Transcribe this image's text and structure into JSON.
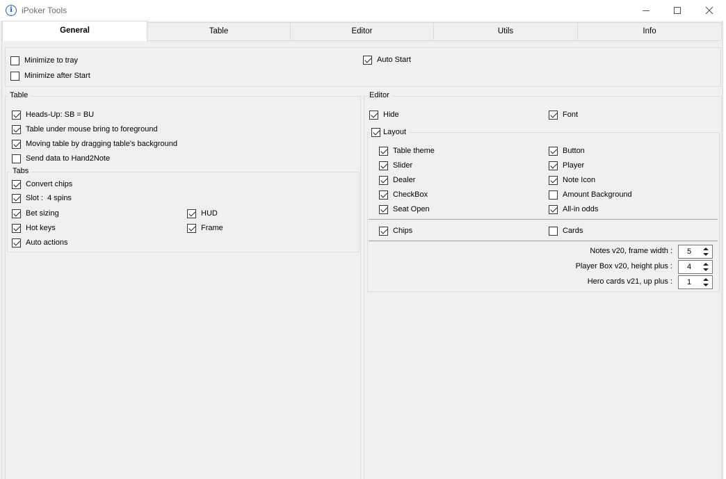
{
  "window": {
    "title": "iPoker Tools",
    "app_icon_glyph": "i",
    "app_icon": "info-icon"
  },
  "tabs": [
    {
      "label": "General"
    },
    {
      "label": "Table"
    },
    {
      "label": "Editor"
    },
    {
      "label": "Utils"
    },
    {
      "label": "Info"
    }
  ],
  "general": {
    "minimize_to_tray": {
      "label": "Minimize to tray",
      "checked": false
    },
    "minimize_after_start": {
      "label": "Minimize after Start",
      "checked": false
    },
    "auto_start": {
      "label": "Auto Start",
      "checked": true
    }
  },
  "table_group": {
    "label": "Table",
    "items": [
      {
        "label": "Heads-Up: SB = BU",
        "checked": true
      },
      {
        "label": "Table under mouse bring to foreground",
        "checked": true
      },
      {
        "label": "Moving table by dragging table's background",
        "checked": true
      },
      {
        "label": "Send data to Hand2Note",
        "checked": false
      }
    ]
  },
  "tabs_group": {
    "label": "Tabs",
    "convert_chips": {
      "label": "Convert chips",
      "checked": true
    },
    "slot": {
      "label": "Slot :",
      "value": "4 spins",
      "checked": true
    },
    "bet_sizing": {
      "label": "Bet sizing",
      "checked": true
    },
    "hud": {
      "label": "HUD",
      "checked": true
    },
    "hot_keys": {
      "label": "Hot keys",
      "checked": true
    },
    "frame": {
      "label": "Frame",
      "checked": true
    },
    "auto_actions": {
      "label": "Auto actions",
      "checked": true
    }
  },
  "editor_group": {
    "label": "Editor",
    "hide": {
      "label": "Hide",
      "checked": true
    },
    "font": {
      "label": "Font",
      "checked": true
    },
    "layout": {
      "label": "Layout",
      "checked": true
    },
    "layout_items": {
      "table_theme": {
        "label": "Table theme",
        "checked": true
      },
      "button": {
        "label": "Button",
        "checked": true
      },
      "slider": {
        "label": "Slider",
        "checked": true
      },
      "player": {
        "label": "Player",
        "checked": true
      },
      "dealer": {
        "label": "Dealer",
        "checked": true
      },
      "note_icon": {
        "label": "Note Icon",
        "checked": true
      },
      "checkbox": {
        "label": "CheckBox",
        "checked": true
      },
      "amount_background": {
        "label": "Amount Background",
        "checked": false
      },
      "seat_open": {
        "label": "Seat Open",
        "checked": true
      },
      "all_in_odds": {
        "label": "All-in odds",
        "checked": true
      }
    },
    "chips": {
      "label": "Chips",
      "checked": true
    },
    "cards": {
      "label": "Cards",
      "checked": false
    },
    "notes_frame_width": {
      "label": "Notes v20, frame width :",
      "value": "5"
    },
    "player_box_height": {
      "label": "Player Box v20, height plus :",
      "value": "4"
    },
    "hero_cards_up": {
      "label": "Hero cards v21, up plus :",
      "value": "1"
    }
  }
}
